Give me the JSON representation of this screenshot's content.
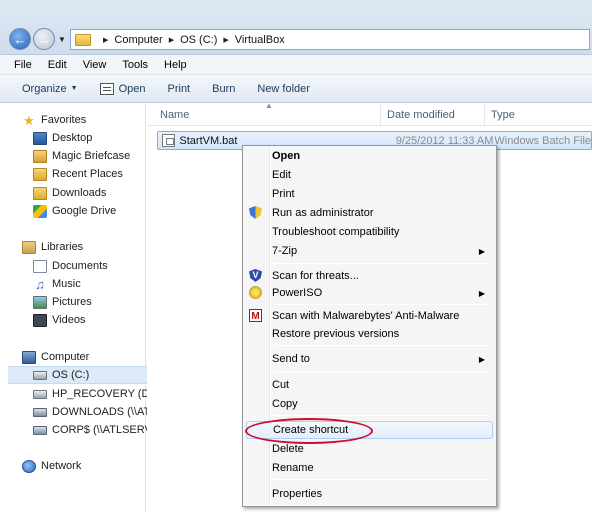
{
  "address": {
    "crumbs": [
      "Computer",
      "OS (C:)",
      "VirtualBox"
    ]
  },
  "menubar": [
    "File",
    "Edit",
    "View",
    "Tools",
    "Help"
  ],
  "toolbar": {
    "organize": "Organize",
    "open": "Open",
    "print": "Print",
    "burn": "Burn",
    "new_folder": "New folder"
  },
  "nav": {
    "favorites": "Favorites",
    "desktop": "Desktop",
    "magic_briefcase": "Magic Briefcase",
    "recent_places": "Recent Places",
    "downloads": "Downloads",
    "google_drive": "Google Drive",
    "libraries": "Libraries",
    "documents": "Documents",
    "music": "Music",
    "pictures": "Pictures",
    "videos": "Videos",
    "computer": "Computer",
    "os_c": "OS (C:)",
    "hp_recovery": "HP_RECOVERY (D:)",
    "downloads_net": "DOWNLOADS (\\\\AT",
    "corps_net": "CORP$ (\\\\ATLSERVE",
    "network": "Network"
  },
  "columns": {
    "name": "Name",
    "date": "Date modified",
    "type": "Type"
  },
  "file": {
    "name": "StartVM.bat",
    "date": "9/25/2012 11:33 AM",
    "type": "Windows Batch File"
  },
  "context_menu": {
    "open": "Open",
    "edit": "Edit",
    "print": "Print",
    "run_admin": "Run as administrator",
    "troubleshoot": "Troubleshoot compatibility",
    "zip": "7-Zip",
    "scan_threats": "Scan for threats...",
    "poweriso": "PowerISO",
    "malwarebytes": "Scan with Malwarebytes' Anti-Malware",
    "restore": "Restore previous versions",
    "send_to": "Send to",
    "cut": "Cut",
    "copy": "Copy",
    "create_shortcut": "Create shortcut",
    "delete": "Delete",
    "rename": "Rename",
    "properties": "Properties"
  },
  "colors": {
    "highlight_ellipse": "#c8102e",
    "selection": "#d2e5fb"
  }
}
